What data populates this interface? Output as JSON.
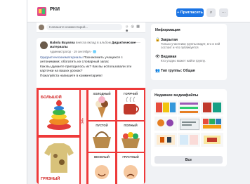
{
  "header": {
    "group_name": "РКИ",
    "invite_label": "+ Пригласить",
    "search_glyph": "⌕",
    "more_glyph": "···"
  },
  "composer": {
    "placeholder": "Напишите комментарий...",
    "icons": "☺ ◎ ▦ ☻"
  },
  "post": {
    "author": "Babola Bayanna",
    "action": "внесла вклад в альбом",
    "album": "Дидактические материалы",
    "meta": "Администратор · 19 сентября · 🌐",
    "more_glyph": "···",
    "hashtag": "#дидактическиематериалы",
    "text_1": "Познакомить учащихся с антонимами; обогатить их словарный запас",
    "text_2": "Как вы думаете пригодилось их? Как вы использовали эти карточки на ваших уроках?",
    "text_3": "Пожалуйста напишите в комментариях!",
    "cards": {
      "bolshoy": "БОЛЬШОЙ",
      "holodny": "ХОЛОДНЫЙ",
      "goryachiy": "ГОРЯЧИЙ",
      "gryazny": "ГРЯЗНЫЙ",
      "chis": "ЧИС",
      "pusto": "ПУСТОЙ",
      "polny": "ПОЛНЫЙ",
      "veselo": "ВЕСЕЛЫЙ",
      "grustny": "ГРУСТНЫЙ"
    }
  },
  "info": {
    "title": "Информация",
    "items": [
      {
        "icon": "🔒",
        "title": "Закрытая",
        "desc": "Только участники группы видят, кто в ней состоит и что публикуется"
      },
      {
        "icon": "👁",
        "title": "Видимая",
        "desc": "Кто угодно может найти группу."
      },
      {
        "icon": "👥",
        "title": "Тип группы: Общая",
        "desc": ""
      }
    ]
  },
  "media": {
    "title": "Недавние медиафайлы",
    "all_label": "Все"
  },
  "colors": {
    "accent": "#1b74e4",
    "card_red": "#ee3a3a",
    "page_bg": "#f0f2f5"
  }
}
